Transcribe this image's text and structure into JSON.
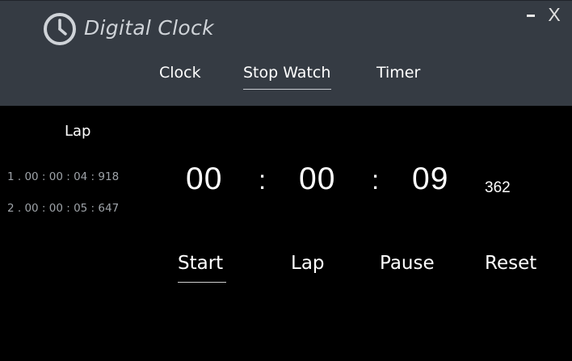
{
  "window": {
    "title": "Digital Clock",
    "minimize_label": "",
    "close_label": "X"
  },
  "tabs": [
    {
      "label": "Clock",
      "active": false
    },
    {
      "label": "Stop Watch",
      "active": true
    },
    {
      "label": "Timer",
      "active": false
    }
  ],
  "laps": {
    "heading": "Lap",
    "entries": [
      "1 . 00 : 00 : 04 : 918",
      "2 . 00 : 00 : 05 : 647"
    ]
  },
  "stopwatch": {
    "hours": "00",
    "minutes": "00",
    "seconds": "09",
    "milliseconds": "362",
    "separator": ":"
  },
  "controls": {
    "start": "Start",
    "lap": "Lap",
    "pause": "Pause",
    "reset": "Reset"
  },
  "colors": {
    "header_bg": "#353b43",
    "body_bg": "#000000",
    "text": "#ffffff",
    "lap_text": "#9ea3a8"
  },
  "icons": {
    "logo": "clock-icon"
  }
}
